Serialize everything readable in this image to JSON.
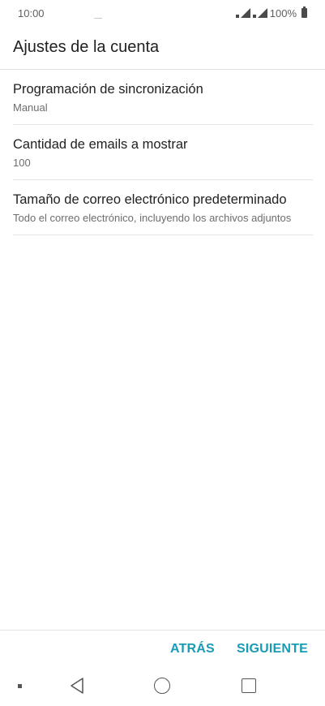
{
  "status_bar": {
    "time": "10:00",
    "battery_text": "100%",
    "icons": [
      "signal-icon",
      "wifi-icon",
      "battery-icon"
    ]
  },
  "header": {
    "title": "Ajustes de la cuenta"
  },
  "settings": {
    "items": [
      {
        "title": "Programación de sincronización",
        "summary": "Manual"
      },
      {
        "title": "Cantidad de emails a mostrar",
        "summary": "100"
      },
      {
        "title": "Tamaño de correo electrónico predeterminado",
        "summary": "Todo el correo electrónico, incluyendo los archivos adjuntos"
      }
    ]
  },
  "footer": {
    "back_label": "ATRÁS",
    "next_label": "SIGUIENTE"
  },
  "colors": {
    "accent": "#1a9bb5",
    "text_primary": "#212121",
    "text_secondary": "#6d6d6d",
    "divider": "#e3e3e3"
  }
}
